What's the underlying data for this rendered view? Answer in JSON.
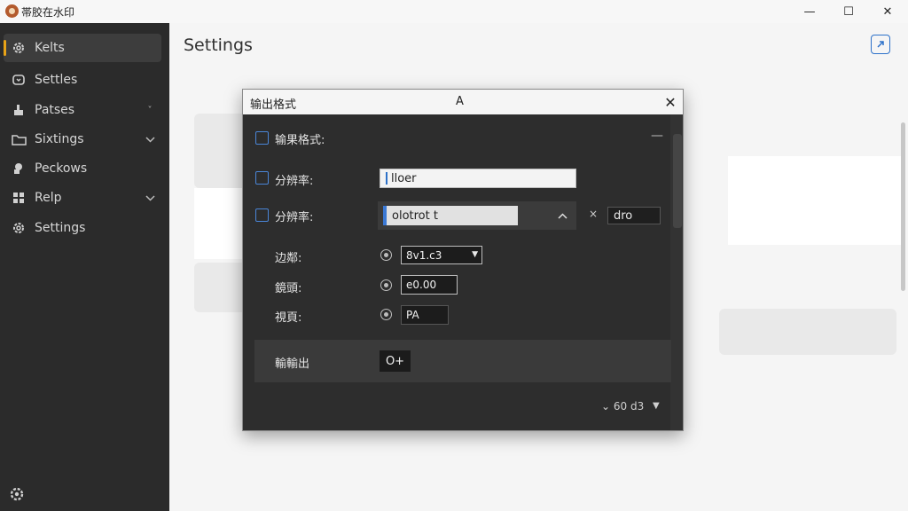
{
  "window": {
    "app_title": "帯胶在水印",
    "minimize_glyph": "—",
    "maximize_glyph": "☐",
    "close_glyph": "✕"
  },
  "sidebar": {
    "items": [
      {
        "label": "Kelts",
        "icon": "gear-icon",
        "active": true,
        "chevron": ""
      },
      {
        "label": "Settles",
        "icon": "document-icon",
        "active": false,
        "chevron": ""
      },
      {
        "label": "Patses",
        "icon": "brush-icon",
        "active": false,
        "chevron": "˅"
      },
      {
        "label": "Sixtings",
        "icon": "folder-icon",
        "active": false,
        "chevron": "⌄"
      },
      {
        "label": "Peckows",
        "icon": "palette-icon",
        "active": false,
        "chevron": ""
      },
      {
        "label": "Relp",
        "icon": "grid-icon",
        "active": false,
        "chevron": "⌄"
      },
      {
        "label": "Settings",
        "icon": "gear-icon",
        "active": false,
        "chevron": ""
      }
    ]
  },
  "main": {
    "title": "Settings"
  },
  "dialog": {
    "title": "输出格式",
    "center_label": "A",
    "close_glyph": "✕",
    "collapse_glyph": "—",
    "row1": {
      "label": "输果格式:"
    },
    "row2": {
      "label": "分辨率:",
      "value": "lloer"
    },
    "row3": {
      "label": "分辨率:",
      "value": "olotrot t",
      "caret": "^",
      "x_label": "×",
      "side_value": "dro"
    },
    "row4": {
      "label": "边鄰:",
      "value": "8v1.c3",
      "dropdown": "▼"
    },
    "row5": {
      "label": "鏡頭:",
      "value": "e0.00"
    },
    "row6": {
      "label": "視頁:",
      "value": "PA"
    },
    "output": {
      "label": "輸輸出",
      "button": "O+"
    },
    "footer": {
      "text": "⌄ 60 d3",
      "dropdown": "▼"
    }
  },
  "colors": {
    "accent_nav": "#e8a317",
    "accent_blue": "#2d71c9",
    "sidebar_bg": "#2b2b2b",
    "dialog_bg": "#2d2d2d"
  }
}
